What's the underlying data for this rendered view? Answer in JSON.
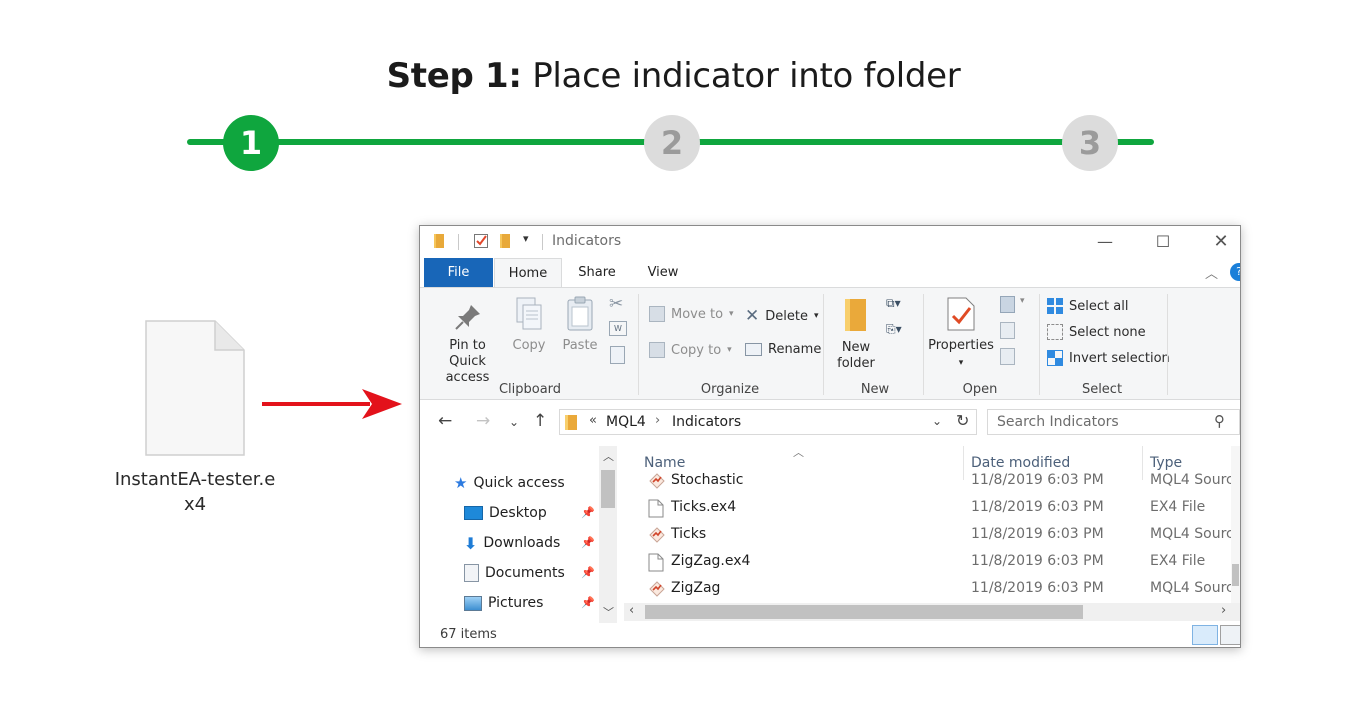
{
  "heading": {
    "bold": "Step 1:",
    "rest": " Place indicator into folder"
  },
  "stepper": {
    "steps": [
      "1",
      "2",
      "3"
    ],
    "active_color": "#0fa63e",
    "inactive_color": "#dcdcdc",
    "active_step": 1
  },
  "desktop_file": {
    "name": "InstantEA-tester.e\nx4"
  },
  "arrow_color": "#e3121b",
  "explorer": {
    "title": "Indicators",
    "tabs": {
      "file": "File",
      "home": "Home",
      "share": "Share",
      "view": "View"
    },
    "ribbon": {
      "clipboard": {
        "pin_line1": "Pin to Quick",
        "pin_line2": "access",
        "copy": "Copy",
        "paste": "Paste",
        "label": "Clipboard"
      },
      "organize": {
        "move_to": "Move to",
        "copy_to": "Copy to",
        "delete": "Delete",
        "rename": "Rename",
        "label": "Organize"
      },
      "new": {
        "line1": "New",
        "line2": "folder",
        "label": "New"
      },
      "open": {
        "properties": "Properties",
        "label": "Open"
      },
      "select": {
        "select_all": "Select all",
        "select_none": "Select none",
        "invert": "Invert selection",
        "label": "Select"
      }
    },
    "address": {
      "chevrons": "«",
      "crumb1": "MQL4",
      "crumb2": "Indicators",
      "search_placeholder": "Search Indicators"
    },
    "nav": {
      "quick_access": "Quick access",
      "items": [
        "Desktop",
        "Downloads",
        "Documents",
        "Pictures"
      ]
    },
    "columns": {
      "name": "Name",
      "date": "Date modified",
      "type": "Type"
    },
    "files": [
      {
        "name": "Stochastic",
        "date": "11/8/2019 6:03 PM",
        "type": "MQL4 Sourc",
        "icon": "mql-icon"
      },
      {
        "name": "Ticks.ex4",
        "date": "11/8/2019 6:03 PM",
        "type": "EX4 File",
        "icon": "file-icon"
      },
      {
        "name": "Ticks",
        "date": "11/8/2019 6:03 PM",
        "type": "MQL4 Sourc",
        "icon": "mql-icon"
      },
      {
        "name": "ZigZag.ex4",
        "date": "11/8/2019 6:03 PM",
        "type": "EX4 File",
        "icon": "file-icon"
      },
      {
        "name": "ZigZag",
        "date": "11/8/2019 6:03 PM",
        "type": "MQL4 Sourc",
        "icon": "mql-icon"
      }
    ],
    "status": "67 items"
  }
}
